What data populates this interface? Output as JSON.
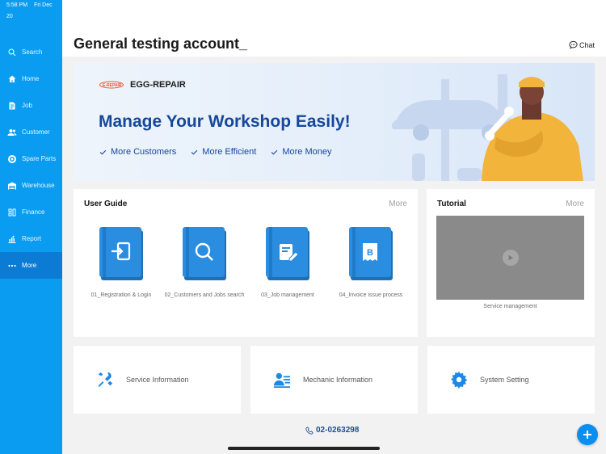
{
  "status_bar": {
    "time": "5:58 PM",
    "date": "Fri Dec 20"
  },
  "sidebar": {
    "items": [
      {
        "label": "Search",
        "icon": "search-icon"
      },
      {
        "label": "Home",
        "icon": "home-icon"
      },
      {
        "label": "Job",
        "icon": "job-icon"
      },
      {
        "label": "Customer",
        "icon": "customer-icon"
      },
      {
        "label": "Spare Parts",
        "icon": "spare-parts-icon"
      },
      {
        "label": "Warehouse",
        "icon": "warehouse-icon"
      },
      {
        "label": "Finance",
        "icon": "finance-icon"
      },
      {
        "label": "Report",
        "icon": "report-icon"
      },
      {
        "label": "More",
        "icon": "more-icon",
        "active": true
      }
    ]
  },
  "header": {
    "title": "General testing account_",
    "chat_label": "Chat"
  },
  "banner": {
    "brand": "EGG-REPAIR",
    "logo_text": "E-REPAIR",
    "headline": "Manage Your Workshop Easily!",
    "bullets": [
      "More Customers",
      "More Efficient",
      "More Money"
    ]
  },
  "user_guide": {
    "title": "User Guide",
    "more": "More",
    "books": [
      {
        "label": "01_Registration & Login",
        "icon": "login-icon"
      },
      {
        "label": "02_Customers and Jobs search",
        "icon": "search-icon"
      },
      {
        "label": "03_Job management",
        "icon": "document-edit-icon"
      },
      {
        "label": "04_Invoice issue process",
        "icon": "invoice-icon"
      }
    ]
  },
  "tutorial": {
    "title": "Tutorial",
    "more": "More",
    "caption": "Service management"
  },
  "tiles": [
    {
      "label": "Service Information",
      "icon": "wrench-screwdriver-icon"
    },
    {
      "label": "Mechanic Information",
      "icon": "mechanic-card-icon"
    },
    {
      "label": "System Setting",
      "icon": "gear-icon"
    }
  ],
  "phone": "02-0263298",
  "colors": {
    "sidebar": "#0a9cf0",
    "sidebar_active": "#0b7bd4",
    "accent": "#1e88e5",
    "headline": "#15489a"
  }
}
